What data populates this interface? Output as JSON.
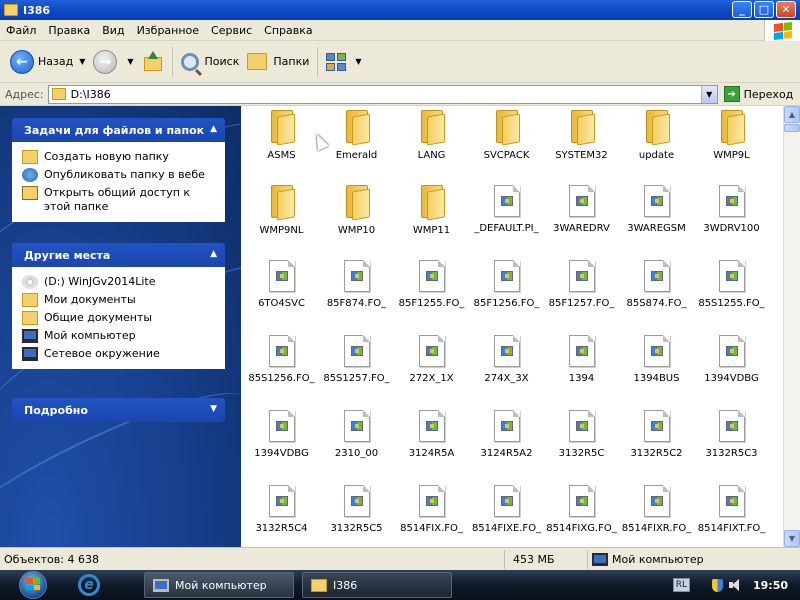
{
  "window": {
    "title": "I386",
    "controls": {
      "minimize": "_",
      "maximize": "□",
      "close": "✕"
    }
  },
  "menu": [
    "Файл",
    "Правка",
    "Вид",
    "Избранное",
    "Сервис",
    "Справка"
  ],
  "toolbar": {
    "back_label": "Назад",
    "search_label": "Поиск",
    "folders_label": "Папки"
  },
  "address": {
    "label": "Адрес:",
    "value": "D:\\I386",
    "go_label": "Переход"
  },
  "sidebar": {
    "tasks": {
      "title": "Задачи для файлов и папок",
      "items": [
        {
          "label": "Создать новую папку",
          "icon": "new-folder-icon"
        },
        {
          "label": "Опубликовать папку в вебе",
          "icon": "publish-web-icon"
        },
        {
          "label": "Открыть общий доступ к этой папке",
          "icon": "share-folder-icon"
        }
      ]
    },
    "places": {
      "title": "Другие места",
      "items": [
        {
          "label": "(D:) WinJGv2014Lite",
          "icon": "cd-drive-icon"
        },
        {
          "label": "Мои документы",
          "icon": "my-documents-icon"
        },
        {
          "label": "Общие документы",
          "icon": "shared-documents-icon"
        },
        {
          "label": "Мой компьютер",
          "icon": "my-computer-icon"
        },
        {
          "label": "Сетевое окружение",
          "icon": "network-icon"
        }
      ]
    },
    "details": {
      "title": "Подробно"
    }
  },
  "files": [
    {
      "name": "ASMS",
      "type": "folder"
    },
    {
      "name": "Emerald",
      "type": "folder"
    },
    {
      "name": "LANG",
      "type": "folder"
    },
    {
      "name": "SVCPACK",
      "type": "folder"
    },
    {
      "name": "SYSTEM32",
      "type": "folder"
    },
    {
      "name": "update",
      "type": "folder"
    },
    {
      "name": "WMP9L",
      "type": "folder"
    },
    {
      "name": "WMP9NL",
      "type": "folder"
    },
    {
      "name": "WMP10",
      "type": "folder"
    },
    {
      "name": "WMP11",
      "type": "folder"
    },
    {
      "name": "_DEFAULT.PI_",
      "type": "file"
    },
    {
      "name": "3WAREDRV",
      "type": "file"
    },
    {
      "name": "3WAREGSM",
      "type": "file"
    },
    {
      "name": "3WDRV100",
      "type": "file"
    },
    {
      "name": "6TO4SVC",
      "type": "file"
    },
    {
      "name": "85F874.FO_",
      "type": "file"
    },
    {
      "name": "85F1255.FO_",
      "type": "file"
    },
    {
      "name": "85F1256.FO_",
      "type": "file"
    },
    {
      "name": "85F1257.FO_",
      "type": "file"
    },
    {
      "name": "85S874.FO_",
      "type": "file"
    },
    {
      "name": "85S1255.FO_",
      "type": "file"
    },
    {
      "name": "85S1256.FO_",
      "type": "file"
    },
    {
      "name": "85S1257.FO_",
      "type": "file"
    },
    {
      "name": "272X_1X",
      "type": "file"
    },
    {
      "name": "274X_3X",
      "type": "file"
    },
    {
      "name": "1394",
      "type": "file"
    },
    {
      "name": "1394BUS",
      "type": "file"
    },
    {
      "name": "1394VDBG",
      "type": "file"
    },
    {
      "name": "1394VDBG",
      "type": "file"
    },
    {
      "name": "2310_00",
      "type": "file"
    },
    {
      "name": "3124R5A",
      "type": "file"
    },
    {
      "name": "3124R5A2",
      "type": "file"
    },
    {
      "name": "3132R5C",
      "type": "file"
    },
    {
      "name": "3132R5C2",
      "type": "file"
    },
    {
      "name": "3132R5C3",
      "type": "file"
    },
    {
      "name": "3132R5C4",
      "type": "file"
    },
    {
      "name": "3132R5C5",
      "type": "file"
    },
    {
      "name": "8514FIX.FO_",
      "type": "file"
    },
    {
      "name": "8514FIXE.FO_",
      "type": "file"
    },
    {
      "name": "8514FIXG.FO_",
      "type": "file"
    },
    {
      "name": "8514FIXR.FO_",
      "type": "file"
    },
    {
      "name": "8514FIXT.FO_",
      "type": "file"
    }
  ],
  "status": {
    "objects": "Объектов: 4 638",
    "size": "453 МБ",
    "location": "Мой компьютер"
  },
  "taskbar": {
    "tasks": [
      {
        "label": "Мой компьютер",
        "icon": "my-computer-icon"
      },
      {
        "label": "I386",
        "icon": "folder-icon"
      }
    ],
    "language": "RL",
    "clock": "19:50"
  }
}
